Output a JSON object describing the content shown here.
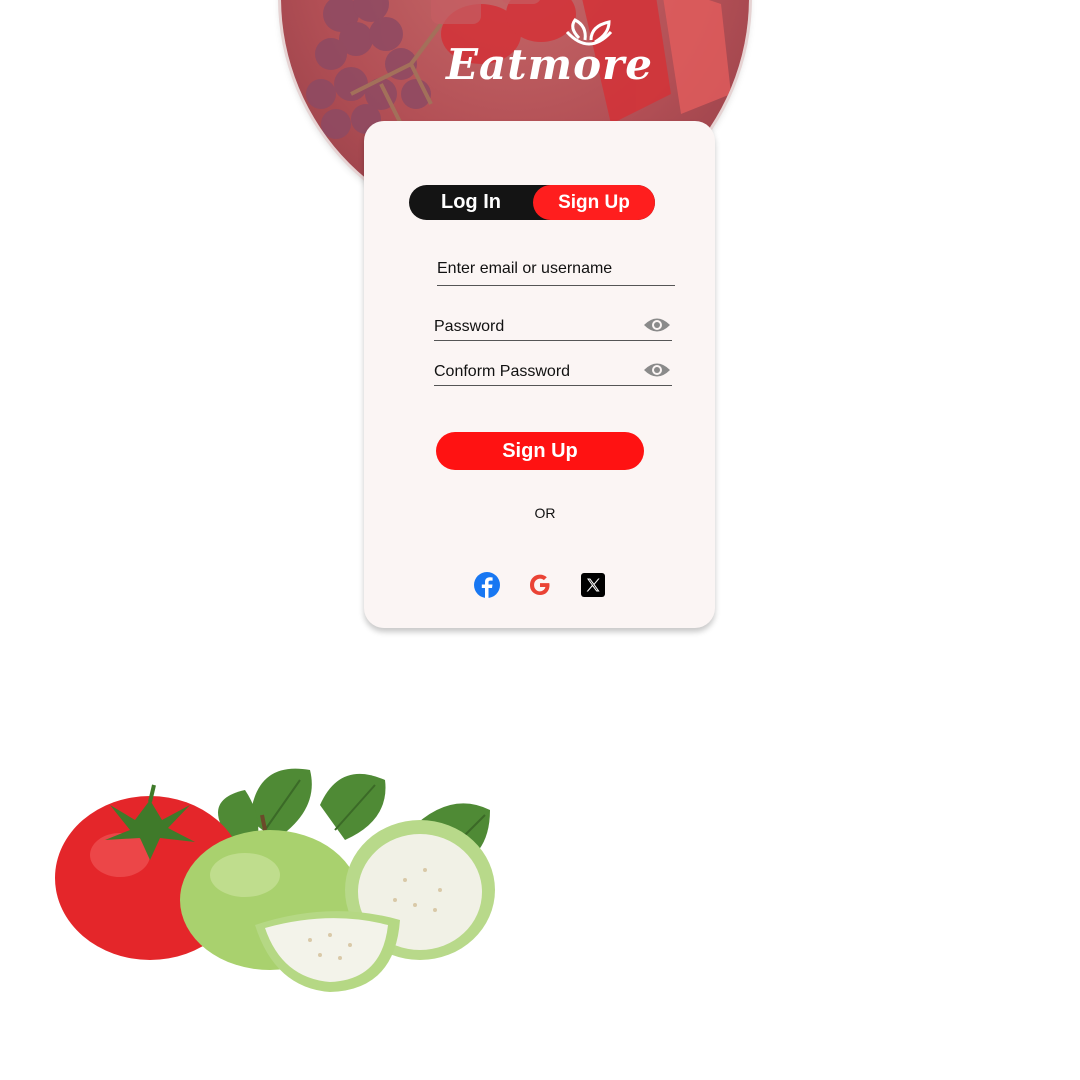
{
  "brand": {
    "name": "Eatmore",
    "icon": "leaf-bowl-icon",
    "accent_color": "#ff1e1e"
  },
  "auth_toggle": {
    "login_label": "Log In",
    "signup_label": "Sign Up",
    "active": "signup"
  },
  "form": {
    "email_placeholder": "Enter email or username",
    "password_placeholder": "Password",
    "confirm_placeholder": "Conform Password",
    "toggle_visibility_icon": "eye-icon",
    "submit_label": "Sign Up",
    "separator": "OR"
  },
  "social": [
    {
      "name": "facebook",
      "icon": "facebook-icon",
      "color": "#1877f2"
    },
    {
      "name": "google",
      "icon": "google-icon",
      "color": "#ea4335"
    },
    {
      "name": "x",
      "icon": "x-icon",
      "color": "#000000"
    }
  ]
}
